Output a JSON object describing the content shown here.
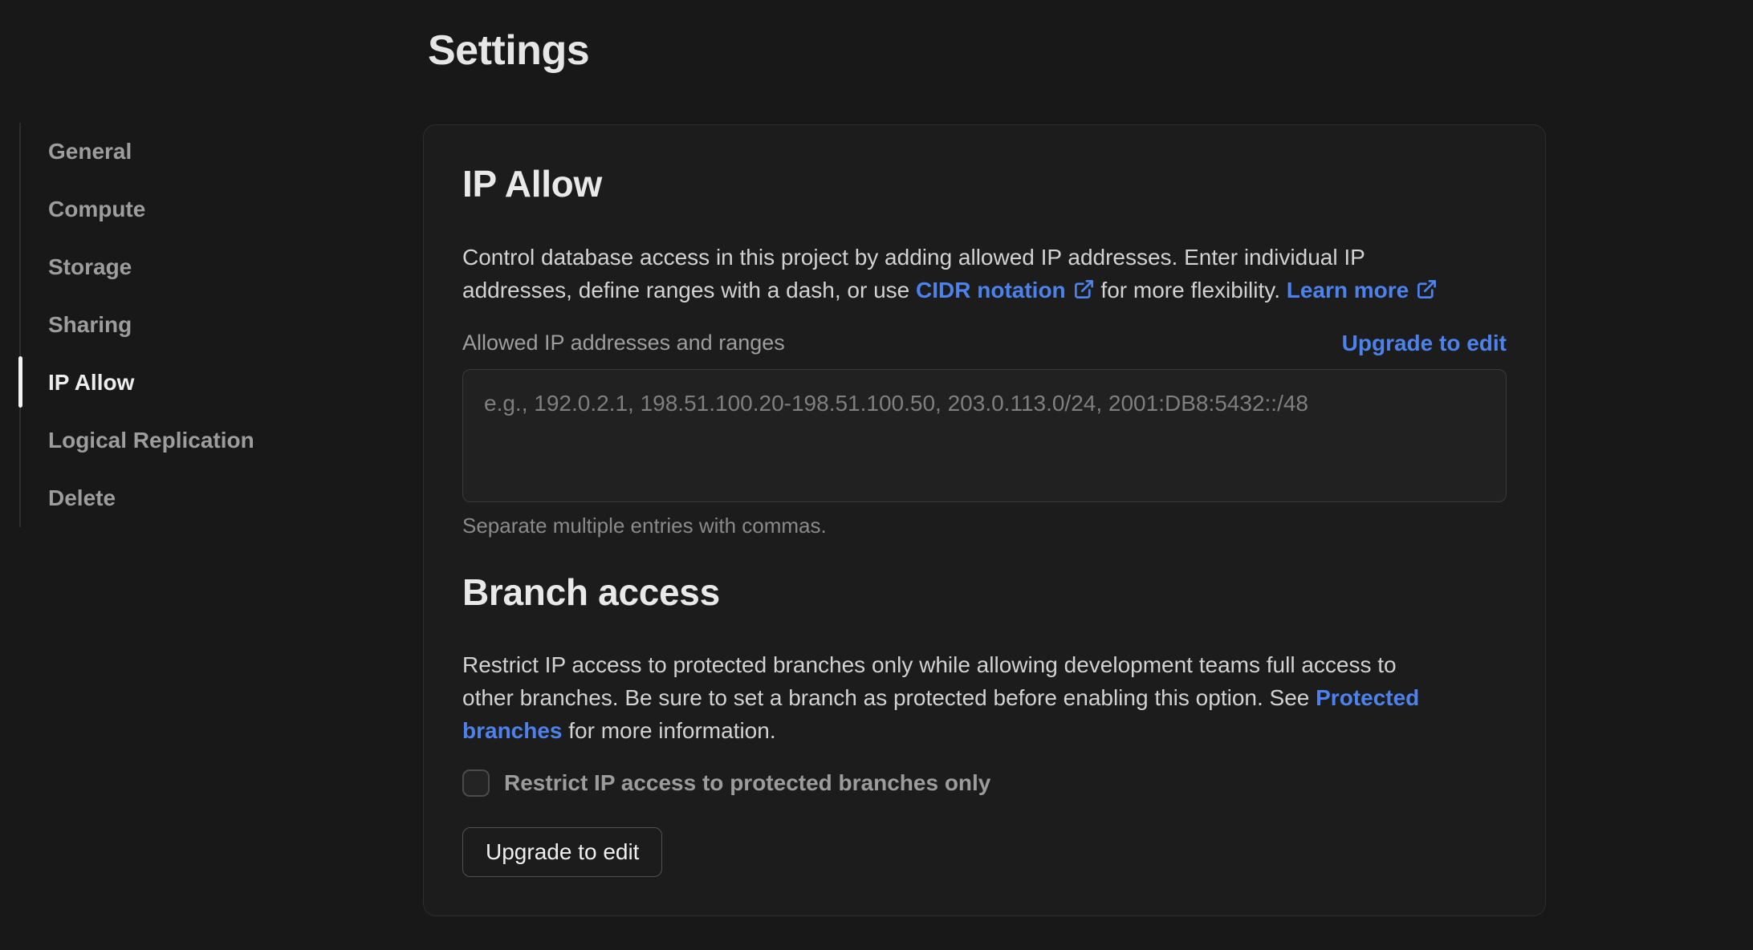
{
  "page": {
    "title": "Settings"
  },
  "colors": {
    "background": "#181818",
    "card_background": "#1c1c1c",
    "border": "#2d2d2d",
    "accent_blue": "#4d82ec",
    "active_indicator": "#f2f2f2",
    "text_primary": "#e6e6e6",
    "text_muted": "#9d9d9d"
  },
  "icons": {
    "external_link": "external-link-icon"
  },
  "sidebar": {
    "items": [
      {
        "label": "General",
        "active": false
      },
      {
        "label": "Compute",
        "active": false
      },
      {
        "label": "Storage",
        "active": false
      },
      {
        "label": "Sharing",
        "active": false
      },
      {
        "label": "IP Allow",
        "active": true
      },
      {
        "label": "Logical Replication",
        "active": false
      },
      {
        "label": "Delete",
        "active": false
      }
    ]
  },
  "ip_allow": {
    "heading": "IP Allow",
    "description_lines": [
      [
        {
          "text": "Control database access in this project by adding allowed IP addresses. Enter individual IP"
        }
      ],
      [
        {
          "text": "addresses, define ranges with a dash, or use "
        },
        {
          "text": "CIDR notation",
          "link": "cidr-notation-link",
          "external_icon": true
        },
        {
          "text": " for more flexibility. "
        },
        {
          "text": "Learn more",
          "link": "learn-more-link",
          "external_icon": true
        }
      ]
    ],
    "field_label": "Allowed IP addresses and ranges",
    "upgrade_link_label": "Upgrade to edit",
    "textarea_value": "",
    "textarea_placeholder": "e.g., 192.0.2.1, 198.51.100.20-198.51.100.50, 203.0.113.0/24, 2001:DB8:5432::/48",
    "helper": "Separate multiple entries with commas."
  },
  "branch_access": {
    "heading": "Branch access",
    "description_lines": [
      [
        {
          "text": "Restrict IP access to protected branches only while allowing development teams full access to"
        }
      ],
      [
        {
          "text": "other branches. Be sure to set a branch as protected before enabling this option. See "
        },
        {
          "text": "Protected",
          "link": "protected-branches-link"
        }
      ],
      [
        {
          "text": "branches",
          "link": "protected-branches-link"
        },
        {
          "text": " for more information."
        }
      ]
    ],
    "checkbox_label": "Restrict IP access to protected branches only",
    "checkbox_checked": false,
    "button_label": "Upgrade to edit"
  }
}
